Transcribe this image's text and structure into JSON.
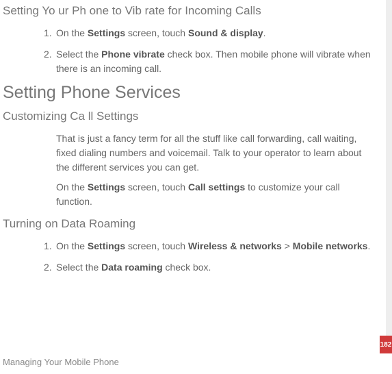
{
  "section1": {
    "title": "Setting Yo ur Ph one  to Vib rate for  Incoming  Calls",
    "items": [
      {
        "num": "1.",
        "prefix": "On the ",
        "bold1": "Settings",
        "mid1": " screen, touch ",
        "bold2": "Sound & display",
        "suffix": "."
      },
      {
        "num": "2.",
        "prefix": "Select the ",
        "bold1": "Phone vibrate",
        "suffix": " check box. Then mobile phone will vibrate when there is an incoming call."
      }
    ]
  },
  "heading2": "Setting Phone Services",
  "section2": {
    "title": "Customizing Ca ll  Settings",
    "para1": "That is just a fancy term for all the stuff like call forwarding, call waiting, fixed dialing numbers and voicemail. Talk to your operator to learn about the different services you can get.",
    "para2_prefix": "On the ",
    "para2_bold1": "Settings",
    "para2_mid": " screen, touch ",
    "para2_bold2": "Call settings",
    "para2_suffix": " to customize your call function."
  },
  "section3": {
    "title": "Turning on  Data  Roaming",
    "items": [
      {
        "num": "1.",
        "prefix": "On the ",
        "bold1": "Settings",
        "mid1": " screen, touch ",
        "bold2": "Wireless & networks",
        "mid2": " > ",
        "bold3": "Mobile networks",
        "suffix": "."
      },
      {
        "num": "2.",
        "prefix": "Select the ",
        "bold1": "Data roaming",
        "suffix": " check box."
      }
    ]
  },
  "footer": "Managing Your Mobile Phone",
  "page_number": "182"
}
